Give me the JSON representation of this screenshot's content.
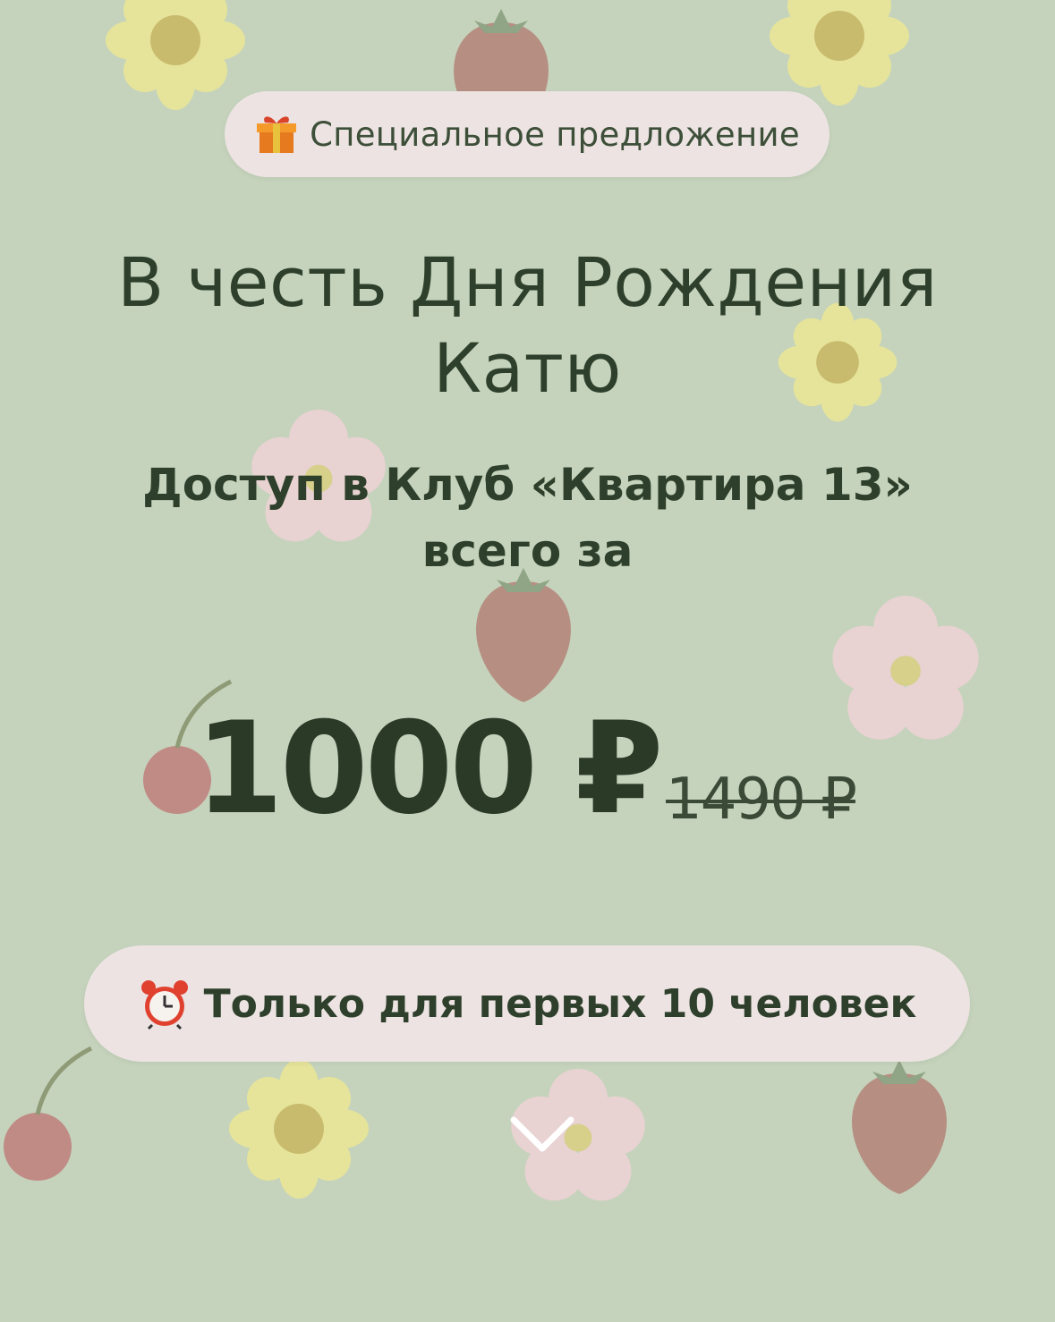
{
  "offer_badge": {
    "icon": "gift-icon",
    "label": "Специальное предложение"
  },
  "headline": {
    "line1": "В честь Дня Рождения",
    "line2": "Катю"
  },
  "subheadline": {
    "line1": "Доступ в Клуб «Квартира 13»",
    "line2": "всего за"
  },
  "price": {
    "current": "1000 ₽",
    "old": "1490 ₽"
  },
  "limit_badge": {
    "icon": "alarm-clock-icon",
    "label": "Только для первых 10 человек"
  },
  "scroll_hint": {
    "icon": "chevron-down-icon"
  },
  "colors": {
    "background": "#c5d3bc",
    "pill": "#ece3e2",
    "text": "#2e402b"
  }
}
